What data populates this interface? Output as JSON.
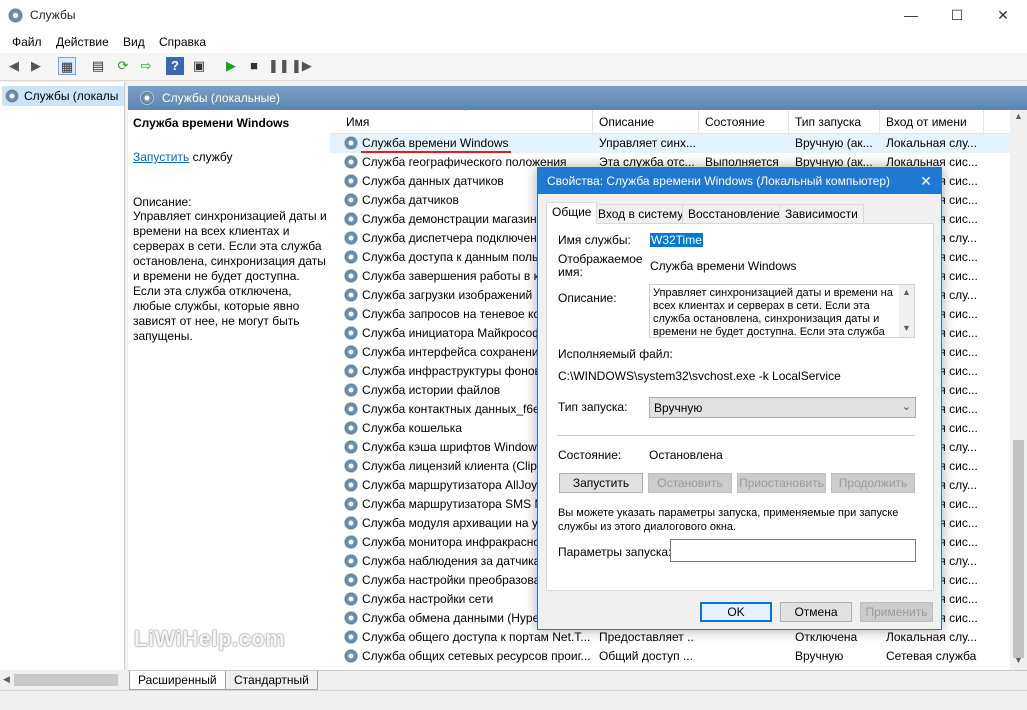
{
  "window": {
    "title": "Службы",
    "min": "—",
    "max": "☐",
    "close": "✕"
  },
  "menu": [
    "Файл",
    "Действие",
    "Вид",
    "Справка"
  ],
  "tree": {
    "item": "Службы (локалы"
  },
  "content": {
    "header": "Службы (локальные)"
  },
  "desc": {
    "title": "Служба времени Windows",
    "action_link": "Запустить",
    "action_rest": " службу",
    "heading": "Описание:",
    "text": "Управляет синхронизацией даты и времени на всех клиентах и серверах в сети. Если эта служба остановлена, синхронизация даты и времени не будет доступна. Если эта служба отключена, любые службы, которые явно зависят от нее, не могут быть запущены."
  },
  "list": {
    "columns": [
      "Имя",
      "Описание",
      "Состояние",
      "Тип запуска",
      "Вход от имени"
    ],
    "rows": [
      {
        "name": "Служба времени Windows",
        "desc": "Управляет синх...",
        "state": "",
        "start": "Вручную (ак...",
        "logon": "Локальная слу..."
      },
      {
        "name": "Служба географического положения",
        "desc": "Эта служба отс...",
        "state": "Выполняется",
        "start": "Вручную (ак...",
        "logon": "Локальная сис..."
      },
      {
        "name": "Служба данных датчиков",
        "desc": "",
        "state": "",
        "start": "",
        "logon": "Локальная сис..."
      },
      {
        "name": "Служба датчиков",
        "desc": "",
        "state": "",
        "start": "",
        "logon": "Локальная сис..."
      },
      {
        "name": "Служба демонстрации магазин",
        "desc": "",
        "state": "",
        "start": "",
        "logon": "Локальная сис..."
      },
      {
        "name": "Служба диспетчера подключен",
        "desc": "",
        "state": "",
        "start": "",
        "logon": "Локальная слу..."
      },
      {
        "name": "Служба доступа к данным поль",
        "desc": "",
        "state": "",
        "start": "",
        "logon": "Локальная сис..."
      },
      {
        "name": "Служба завершения работы в к",
        "desc": "",
        "state": "",
        "start": "",
        "logon": "Локальная сис..."
      },
      {
        "name": "Служба загрузки изображений",
        "desc": "",
        "state": "",
        "start": "",
        "logon": "Локальная слу..."
      },
      {
        "name": "Служба запросов на теневое ко",
        "desc": "",
        "state": "",
        "start": "",
        "logon": "Локальная сис..."
      },
      {
        "name": "Служба инициатора Майкрософ",
        "desc": "",
        "state": "",
        "start": "",
        "logon": "Локальная сис..."
      },
      {
        "name": "Служба интерфейса сохранени",
        "desc": "",
        "state": "",
        "start": "",
        "logon": "Локальная сис..."
      },
      {
        "name": "Служба инфраструктуры фонов",
        "desc": "",
        "state": "",
        "start": "",
        "logon": "Локальная сис..."
      },
      {
        "name": "Служба истории файлов",
        "desc": "",
        "state": "",
        "start": "",
        "logon": "Локальная сис..."
      },
      {
        "name": "Служба контактных данных_f6e",
        "desc": "",
        "state": "",
        "start": "",
        "logon": "Локальная сис..."
      },
      {
        "name": "Служба кошелька",
        "desc": "",
        "state": "",
        "start": "",
        "logon": "Локальная сис..."
      },
      {
        "name": "Служба кэша шрифтов Window",
        "desc": "",
        "state": "",
        "start": "",
        "logon": "Локальная слу..."
      },
      {
        "name": "Служба лицензий клиента (Clip",
        "desc": "",
        "state": "",
        "start": "",
        "logon": "Локальная сис..."
      },
      {
        "name": "Служба маршрутизатора AllJoy",
        "desc": "",
        "state": "",
        "start": "",
        "logon": "Локальная слу..."
      },
      {
        "name": "Служба маршрутизатора SMS M",
        "desc": "",
        "state": "",
        "start": "",
        "logon": "Локальная сис..."
      },
      {
        "name": "Служба модуля архивации на у",
        "desc": "",
        "state": "",
        "start": "",
        "logon": "Локальная сис..."
      },
      {
        "name": "Служба монитора инфракрасно",
        "desc": "",
        "state": "",
        "start": "",
        "logon": "Локальная сис..."
      },
      {
        "name": "Служба наблюдения за датчика",
        "desc": "",
        "state": "",
        "start": "",
        "logon": "Локальная слу..."
      },
      {
        "name": "Служба настройки преобразова",
        "desc": "",
        "state": "",
        "start": "",
        "logon": "Локальная сис..."
      },
      {
        "name": "Служба настройки сети",
        "desc": "",
        "state": "",
        "start": "",
        "logon": "Локальная сис..."
      },
      {
        "name": "Служба обмена данными (Hyper",
        "desc": "",
        "state": "",
        "start": "",
        "logon": "Локальная сис..."
      },
      {
        "name": "Служба общего доступа к портам Net.T...",
        "desc": "Предоставляет ...",
        "state": "",
        "start": "Отключена",
        "logon": "Локальная слу..."
      },
      {
        "name": "Служба общих сетевых ресурсов проиг...",
        "desc": "Общий доступ ...",
        "state": "",
        "start": "Вручную",
        "logon": "Сетевая служба"
      }
    ]
  },
  "bottom_tabs": [
    "Расширенный",
    "Стандартный"
  ],
  "watermark": "LiWiHelp.com",
  "dialog": {
    "title": "Свойства: Служба времени Windows (Локальный компьютер)",
    "close": "✕",
    "tabs": [
      "Общие",
      "Вход в систему",
      "Восстановление",
      "Зависимости"
    ],
    "service_name_label": "Имя службы:",
    "service_name": "W32Time",
    "display_name_label_1": "Отображаемое",
    "display_name_label_2": "имя:",
    "display_name": "Служба времени Windows",
    "description_label": "Описание:",
    "description": "Управляет синхронизацией даты и времени на всех клиентах и серверах в сети. Если эта служба остановлена, синхронизация даты и времени не будет доступна. Если эта служба",
    "exe_label": "Исполняемый файл:",
    "exe_path": "C:\\WINDOWS\\system32\\svchost.exe -k LocalService",
    "startup_type_label": "Тип запуска:",
    "startup_type": "Вручную",
    "status_label": "Состояние:",
    "status": "Остановлена",
    "btn_start": "Запустить",
    "btn_stop": "Остановить",
    "btn_pause": "Приостановить",
    "btn_resume": "Продолжить",
    "hint": "Вы можете указать параметры запуска, применяемые при запуске службы из этого диалогового окна.",
    "params_label": "Параметры запуска:",
    "params_value": "",
    "ok": "OK",
    "cancel": "Отмена",
    "apply": "Применить"
  }
}
